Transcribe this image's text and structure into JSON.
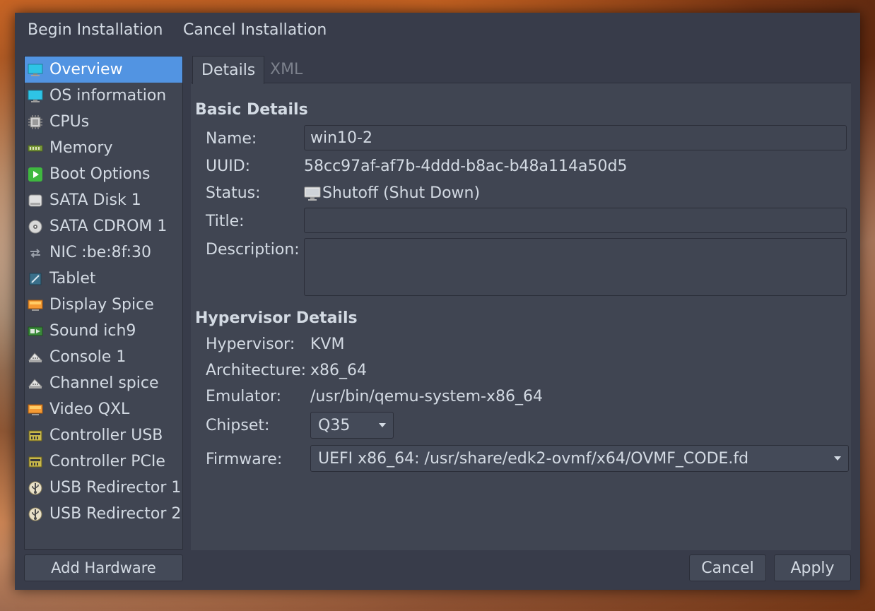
{
  "menubar": {
    "begin_install": "Begin Installation",
    "cancel_install": "Cancel Installation"
  },
  "sidebar": {
    "items": [
      {
        "label": "Overview",
        "icon": "monitor-icon",
        "selected": true
      },
      {
        "label": "OS information",
        "icon": "monitor-icon"
      },
      {
        "label": "CPUs",
        "icon": "cpu-icon"
      },
      {
        "label": "Memory",
        "icon": "memory-icon"
      },
      {
        "label": "Boot Options",
        "icon": "play-icon"
      },
      {
        "label": "SATA Disk 1",
        "icon": "disk-icon"
      },
      {
        "label": "SATA CDROM 1",
        "icon": "cdrom-icon"
      },
      {
        "label": "NIC :be:8f:30",
        "icon": "network-icon"
      },
      {
        "label": "Tablet",
        "icon": "tablet-icon"
      },
      {
        "label": "Display Spice",
        "icon": "display-icon"
      },
      {
        "label": "Sound ich9",
        "icon": "sound-icon"
      },
      {
        "label": "Console 1",
        "icon": "serial-icon"
      },
      {
        "label": "Channel spice",
        "icon": "serial-icon"
      },
      {
        "label": "Video QXL",
        "icon": "display-icon"
      },
      {
        "label": "Controller USB",
        "icon": "controller-icon"
      },
      {
        "label": "Controller PCIe",
        "icon": "controller-icon"
      },
      {
        "label": "USB Redirector 1",
        "icon": "usb-icon"
      },
      {
        "label": "USB Redirector 2",
        "icon": "usb-icon"
      }
    ],
    "add_hardware": "Add Hardware"
  },
  "tabs": {
    "details": "Details",
    "xml": "XML"
  },
  "basic": {
    "title": "Basic Details",
    "name_label": "Name:",
    "name_value": "win10-2",
    "uuid_label": "UUID:",
    "uuid_value": "58cc97af-af7b-4ddd-b8ac-b48a114a50d5",
    "status_label": "Status:",
    "status_value": "Shutoff (Shut Down)",
    "title_label": "Title:",
    "title_value": "",
    "description_label": "Description:",
    "description_value": ""
  },
  "hypervisor": {
    "title": "Hypervisor Details",
    "hypervisor_label": "Hypervisor:",
    "hypervisor_value": "KVM",
    "arch_label": "Architecture:",
    "arch_value": "x86_64",
    "emulator_label": "Emulator:",
    "emulator_value": "/usr/bin/qemu-system-x86_64",
    "chipset_label": "Chipset:",
    "chipset_value": "Q35",
    "firmware_label": "Firmware:",
    "firmware_value": "UEFI x86_64: /usr/share/edk2-ovmf/x64/OVMF_CODE.fd"
  },
  "buttons": {
    "cancel": "Cancel",
    "apply": "Apply"
  },
  "colors": {
    "window_bg": "#383c4a",
    "panel_bg": "#404552",
    "selection": "#5294e2",
    "text": "#d3dae3",
    "muted_text": "#7c818c"
  }
}
